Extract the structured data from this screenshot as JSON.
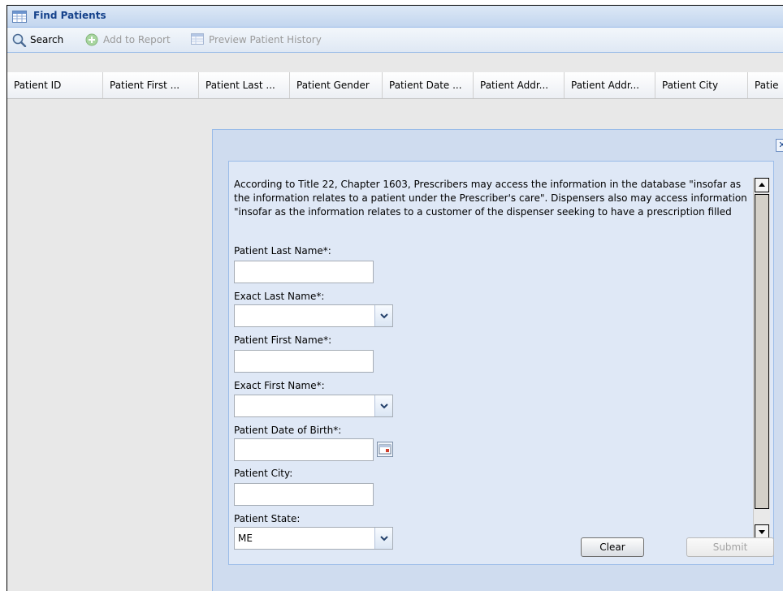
{
  "panel": {
    "title": "Find Patients",
    "icon": "grid-icon"
  },
  "toolbar": {
    "search_label": "Search",
    "add_label": "Add to Report",
    "preview_label": "Preview Patient History"
  },
  "grid": {
    "columns": [
      "Patient ID",
      "Patient First ...",
      "Patient Last ...",
      "Patient Gender",
      "Patient Date ...",
      "Patient Addr...",
      "Patient Addr...",
      "Patient City",
      "Patie"
    ]
  },
  "dialog": {
    "close_symbol": "✕",
    "notice": "According to Title 22, Chapter 1603, Prescribers may access the information in the database \"insofar as the information relates to a patient under the Prescriber's care\". Dispensers also may access information \"insofar as the information relates to a customer of the dispenser seeking to have a prescription filled",
    "fields": {
      "last_name_label": "Patient Last Name*:",
      "exact_last_label": "Exact Last Name*:",
      "first_name_label": "Patient First Name*:",
      "exact_first_label": "Exact First Name*:",
      "dob_label": "Patient Date of Birth*:",
      "city_label": "Patient City:",
      "state_label": "Patient State:",
      "state_value": "ME"
    },
    "buttons": {
      "clear": "Clear",
      "submit": "Submit"
    }
  },
  "colors": {
    "header_text": "#15428b",
    "border_blue": "#99bbe8",
    "dialog_bg": "#cfdcef"
  }
}
